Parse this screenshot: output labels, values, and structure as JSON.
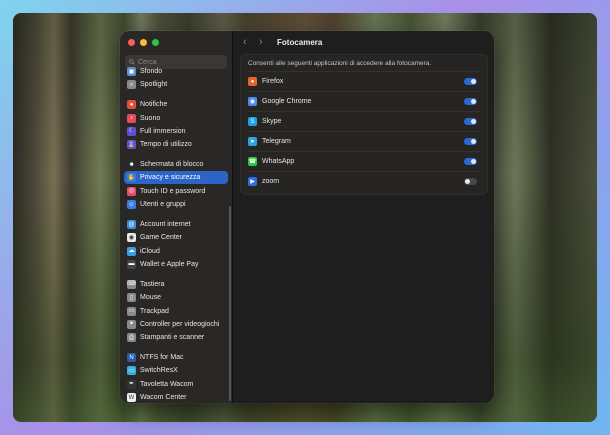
{
  "search": {
    "placeholder": "Cerca"
  },
  "sidebar": {
    "groups": [
      [
        {
          "label": "Sfondo",
          "icon": "wallpaper-icon",
          "color": "#5a8fd8"
        },
        {
          "label": "Spotlight",
          "icon": "spotlight-icon",
          "color": "#8a8a8e"
        }
      ],
      [
        {
          "label": "Notifiche",
          "icon": "notifications-icon",
          "color": "#e74c3c"
        },
        {
          "label": "Suono",
          "icon": "sound-icon",
          "color": "#e74c5c"
        },
        {
          "label": "Full immersion",
          "icon": "focus-icon",
          "color": "#5b4fd6"
        },
        {
          "label": "Tempo di utilizzo",
          "icon": "screen-time-icon",
          "color": "#6a4fd6"
        }
      ],
      [
        {
          "label": "Schermata di blocco",
          "icon": "lock-screen-icon",
          "color": "#2a2a2a"
        },
        {
          "label": "Privacy e sicurezza",
          "icon": "hand-icon",
          "color": "#3a7de0",
          "selected": true
        },
        {
          "label": "Touch ID e password",
          "icon": "fingerprint-icon",
          "color": "#e0506a"
        },
        {
          "label": "Utenti e gruppi",
          "icon": "users-icon",
          "color": "#3a7de0"
        }
      ],
      [
        {
          "label": "Account internet",
          "icon": "at-icon",
          "color": "#3a8de0"
        },
        {
          "label": "Game Center",
          "icon": "game-center-icon",
          "color": "#e8e8e8"
        },
        {
          "label": "iCloud",
          "icon": "cloud-icon",
          "color": "#3a9de0"
        },
        {
          "label": "Wallet e Apple Pay",
          "icon": "wallet-icon",
          "color": "#444444"
        }
      ],
      [
        {
          "label": "Tastiera",
          "icon": "keyboard-icon",
          "color": "#8a8a8e"
        },
        {
          "label": "Mouse",
          "icon": "mouse-icon",
          "color": "#8a8a8e"
        },
        {
          "label": "Trackpad",
          "icon": "trackpad-icon",
          "color": "#8a8a8e"
        },
        {
          "label": "Controller per videogiochi",
          "icon": "gamepad-icon",
          "color": "#8a8a8e"
        },
        {
          "label": "Stampanti e scanner",
          "icon": "printer-icon",
          "color": "#8a8a8e"
        }
      ],
      [
        {
          "label": "NTFS for Mac",
          "icon": "ntfs-icon",
          "color": "#2a5aa8"
        },
        {
          "label": "SwitchResX",
          "icon": "display-icon",
          "color": "#3ab0e0"
        },
        {
          "label": "Tavoletta Wacom",
          "icon": "wacom-pen-icon",
          "color": "#333333"
        },
        {
          "label": "Wacom Center",
          "icon": "wacom-icon",
          "color": "#f0f0f0"
        }
      ]
    ]
  },
  "content": {
    "title": "Fotocamera",
    "description": "Consenti alle seguenti applicazioni di accedere alla fotocamera.",
    "apps": [
      {
        "name": "Firefox",
        "icon": "firefox-icon",
        "color": "#e8632b",
        "enabled": true
      },
      {
        "name": "Google Chrome",
        "icon": "chrome-icon",
        "color": "#4a8af4",
        "enabled": true
      },
      {
        "name": "Skype",
        "icon": "skype-icon",
        "color": "#1ea0e8",
        "enabled": true
      },
      {
        "name": "Telegram",
        "icon": "telegram-icon",
        "color": "#2aa3df",
        "enabled": true
      },
      {
        "name": "WhatsApp",
        "icon": "whatsapp-icon",
        "color": "#28c840",
        "enabled": true
      },
      {
        "name": "zoom",
        "icon": "zoom-icon",
        "color": "#2d6ee6",
        "enabled": false
      }
    ]
  }
}
